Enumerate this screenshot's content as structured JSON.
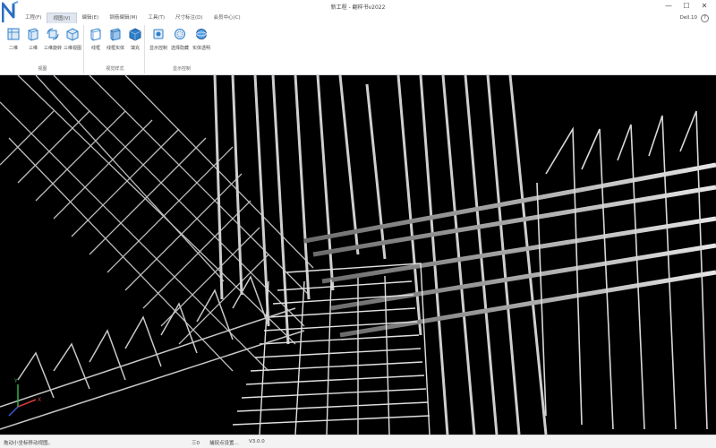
{
  "window": {
    "title": "新工程 - 翻样书v2022",
    "min_symbol": "—",
    "max_symbol": "☐",
    "close_symbol": "✕"
  },
  "menu": {
    "tabs": [
      "工程(F)",
      "视图(V)",
      "编辑(E)",
      "钢筋编辑(M)",
      "工具(T)",
      "尺寸标注(D)",
      "会员中心(C)"
    ],
    "active_index": 1,
    "right_label": "Dell.10",
    "help_symbol": "?"
  },
  "ribbon": {
    "groups": [
      {
        "label": "视图",
        "buttons": [
          "二维",
          "三维",
          "三维旋转",
          "三维视图"
        ]
      },
      {
        "label": "视觉样式",
        "buttons": [
          "线框",
          "线框实体",
          "填充"
        ]
      },
      {
        "label": "显示控制",
        "buttons": [
          "显示控制",
          "选择隐藏",
          "实体透明"
        ]
      }
    ]
  },
  "status": {
    "message": "拖动小坐标移动视图。",
    "mid_value": "三0",
    "settings_label": "捕捉点设置...",
    "version": "V3.0.0"
  },
  "axis": {
    "x_label": "X",
    "y_label": "Y"
  },
  "colors": {
    "viewport_bg": "#000000",
    "rebar": "#b9b9b9",
    "accent": "#2e7fc9",
    "axis_x": "#d63b3b",
    "axis_y": "#33b04a",
    "axis_z": "#3b5bd6"
  }
}
